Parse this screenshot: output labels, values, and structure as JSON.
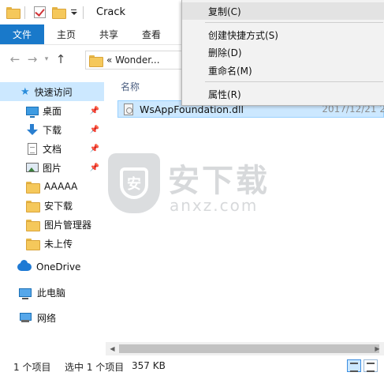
{
  "title_bar": {
    "title": "Crack",
    "folder_icon": "folder-icon",
    "properties_icon": "properties-checkbox-icon",
    "customize_icon": "chevron-down-icon"
  },
  "ribbon": {
    "tabs": [
      {
        "label": "文件"
      },
      {
        "label": "主页"
      },
      {
        "label": "共享"
      },
      {
        "label": "查看"
      }
    ],
    "file_tab_color": "#1979ca"
  },
  "address": {
    "path": "« Wonder..."
  },
  "sidebar": {
    "quick_access": "快速访问",
    "items": [
      {
        "label": "桌面",
        "icon": "desktop-icon",
        "pinned": true
      },
      {
        "label": "下载",
        "icon": "download-icon",
        "pinned": true
      },
      {
        "label": "文档",
        "icon": "document-icon",
        "pinned": true
      },
      {
        "label": "图片",
        "icon": "pictures-icon",
        "pinned": true
      },
      {
        "label": "AAAAA",
        "icon": "folder-icon",
        "pinned": false
      },
      {
        "label": "安下载",
        "icon": "folder-icon",
        "pinned": false
      },
      {
        "label": "图片管理器",
        "icon": "folder-icon",
        "pinned": false
      },
      {
        "label": "未上传",
        "icon": "folder-icon",
        "pinned": false
      }
    ],
    "onedrive": "OneDrive",
    "this_pc": "此电脑",
    "network": "网络",
    "selected_color": "#cce8ff"
  },
  "main": {
    "column_name": "名称",
    "files": [
      {
        "name": "WsAppFoundation.dll",
        "date": "2017/12/21 2",
        "icon": "dll-file-icon",
        "selected": true
      }
    ]
  },
  "watermark": {
    "shield_char": "安",
    "title": "安下载",
    "subtitle": "anxz.com"
  },
  "status_bar": {
    "item_count": "1 个项目",
    "selected": "选中 1 个项目",
    "size": "357 KB"
  },
  "context_menu": {
    "items": [
      {
        "label": "复制(C)"
      },
      {
        "label": "创建快捷方式(S)"
      },
      {
        "label": "删除(D)"
      },
      {
        "label": "重命名(M)"
      },
      {
        "label": "属性(R)"
      }
    ],
    "background": "#f2f2f2"
  }
}
